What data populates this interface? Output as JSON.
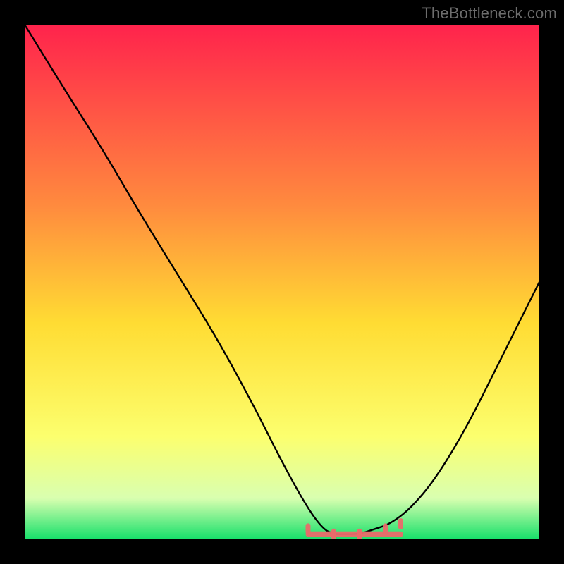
{
  "watermark": "TheBottleneck.com",
  "colors": {
    "bg": "#000000",
    "watermark": "#6d6d6d",
    "curve": "#000000",
    "tick": "#ea6a6a",
    "grad_top": "#ff234c",
    "grad_mid1": "#ff8a3e",
    "grad_mid2": "#ffdc33",
    "grad_mid3": "#fcff6e",
    "grad_mid4": "#d9ffb0",
    "grad_bot": "#16e06a"
  },
  "chart_data": {
    "type": "line",
    "title": "",
    "xlabel": "",
    "ylabel": "",
    "xlim": [
      0,
      100
    ],
    "ylim": [
      0,
      100
    ],
    "grid": false,
    "legend": false,
    "annotations": [],
    "series": [
      {
        "name": "bottleneck-curve",
        "x": [
          0,
          8,
          15,
          22,
          30,
          38,
          45,
          50,
          55,
          58,
          60,
          62,
          65,
          68,
          71,
          75,
          80,
          86,
          92,
          100
        ],
        "y": [
          100,
          87,
          76,
          64,
          51,
          38,
          25,
          15,
          6,
          2,
          1,
          1,
          1,
          2,
          3,
          6,
          12,
          22,
          34,
          50
        ]
      },
      {
        "name": "flat-bottom",
        "x": [
          55,
          60,
          65,
          70,
          73
        ],
        "y": [
          2,
          1,
          1,
          2,
          3
        ]
      }
    ]
  }
}
